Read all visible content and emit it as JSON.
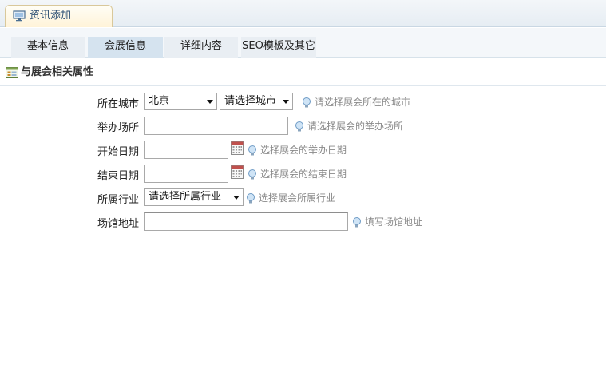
{
  "header": {
    "tab_label": "资讯添加"
  },
  "subtabs": [
    {
      "label": "基本信息",
      "active": false
    },
    {
      "label": "会展信息",
      "active": true
    },
    {
      "label": "详细内容",
      "active": false
    },
    {
      "label": "SEO模板及其它",
      "active": false
    }
  ],
  "section": {
    "title": "与展会相关属性"
  },
  "form": {
    "city": {
      "label": "所在城市",
      "province_value": "北京",
      "city_value": "请选择城市",
      "hint": "请选择展会所在的城市"
    },
    "venue": {
      "label": "举办场所",
      "value": "",
      "hint": "请选择展会的举办场所"
    },
    "start_date": {
      "label": "开始日期",
      "value": "",
      "hint": "选择展会的举办日期"
    },
    "end_date": {
      "label": "结束日期",
      "value": "",
      "hint": "选择展会的结束日期"
    },
    "industry": {
      "label": "所属行业",
      "value": "请选择所属行业",
      "hint": "选择展会所属行业"
    },
    "address": {
      "label": "场馆地址",
      "value": "",
      "hint": "填写场馆地址"
    }
  },
  "colors": {
    "hint_text": "#8a8a8a",
    "active_tab": "#d5e3ef",
    "header_tab_text": "#2c4f73"
  }
}
